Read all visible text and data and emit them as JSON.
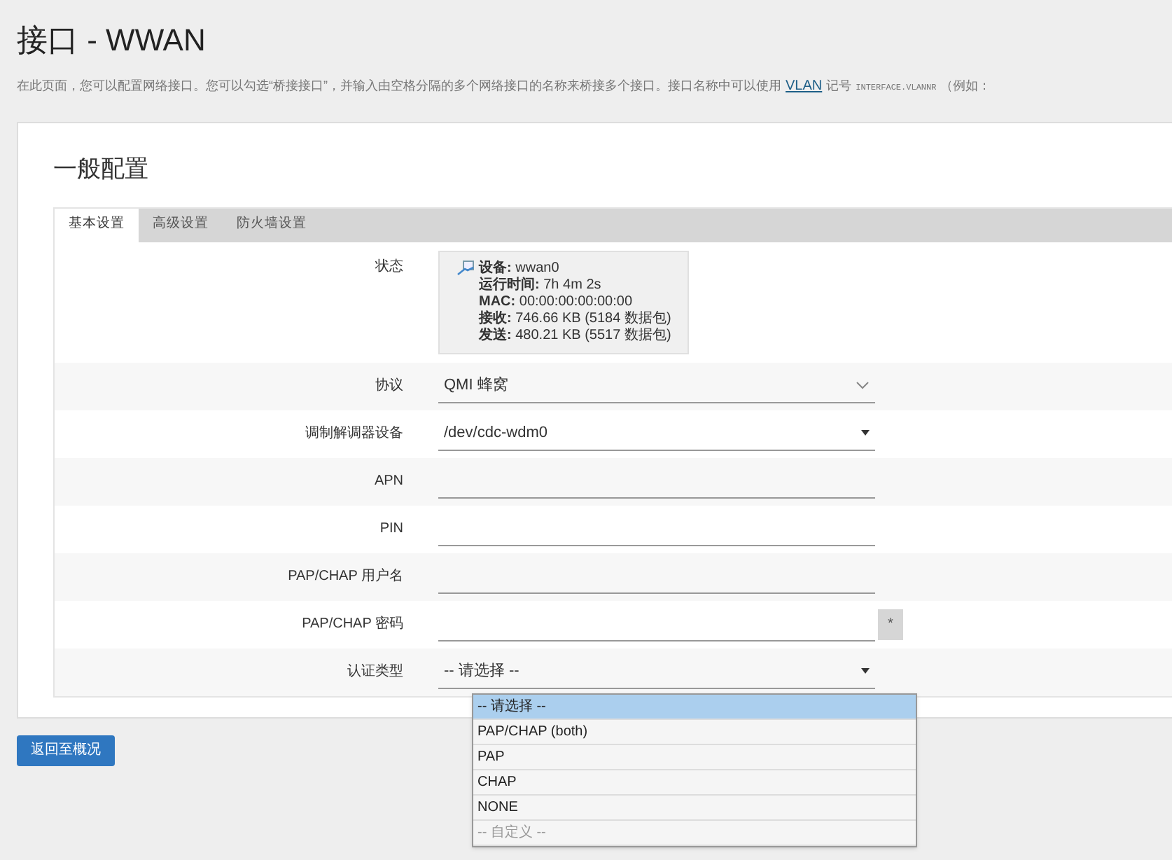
{
  "page": {
    "title": "接口 - WWAN",
    "description": "在此页面，您可以配置网络接口。您可以勾选“桥接接口”，并输入由空格分隔的多个网络接口的名称来桥接多个接口。接口名称中可以使用",
    "description_link": "VLAN",
    "description_after": "记号",
    "description_code": "INTERFACE.VLANNR",
    "description_tail": "（例如："
  },
  "section": {
    "title": "一般配置"
  },
  "tabs": [
    {
      "label": "基本设置",
      "selected": true
    },
    {
      "label": "高级设置",
      "selected": false
    },
    {
      "label": "防火墙设置",
      "selected": false
    }
  ],
  "status": {
    "label": "状态",
    "lines": [
      "**设备:** wwan0",
      "**运行时间:** 7h 4m 2s",
      "**MAC:** 00:00:00:00:00:00",
      "**接收:** 746.66 KB (5184 数据包)",
      "**发送:** 480.21 KB (5517 数据包)"
    ]
  },
  "fields": [
    {
      "label": "协议",
      "kind": "combo",
      "value": "QMI 蜂窝"
    },
    {
      "label": "调制解调器设备",
      "kind": "select",
      "value": "/dev/cdc-wdm0"
    },
    {
      "label": "APN",
      "kind": "text"
    },
    {
      "label": "PIN",
      "kind": "text"
    },
    {
      "label": "PAP/CHAP 用户名",
      "kind": "text"
    },
    {
      "label": "PAP/CHAP 密码",
      "kind": "password",
      "reveal": "*"
    },
    {
      "label": "认证类型",
      "kind": "select",
      "value": "-- 请选择 --"
    }
  ],
  "dropdown": {
    "options": [
      {
        "label": "-- 请选择 --",
        "selected": true,
        "disabled": false
      },
      {
        "label": "PAP/CHAP (both)",
        "selected": false,
        "disabled": false
      },
      {
        "label": "PAP",
        "selected": false,
        "disabled": false
      },
      {
        "label": "CHAP",
        "selected": false,
        "disabled": false
      },
      {
        "label": "NONE",
        "selected": false,
        "disabled": false
      },
      {
        "label": "-- 自定义 --",
        "selected": false,
        "disabled": true
      }
    ]
  },
  "back_button": "返回至概况"
}
